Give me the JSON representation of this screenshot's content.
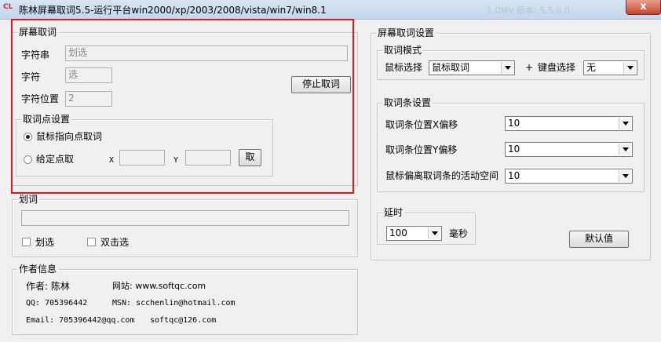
{
  "window": {
    "icon_text": "CL",
    "title": "陈林屏幕取词5.5-运行平台win2000/xp/2003/2008/vista/win7/win8.1",
    "ghost_text": "1.0MV   版本: 5.5.0.0",
    "close_glyph": "x"
  },
  "capture": {
    "legend": "屏幕取词",
    "string_label": "字符串",
    "string_value": "划选",
    "char_label": "字符",
    "char_value": "选",
    "pos_label": "字符位置",
    "pos_value": "2",
    "stop_button": "停止取词",
    "point_group": {
      "legend": "取词点设置",
      "option_mouse": "鼠标指向点取词",
      "option_fixed": "给定点取",
      "x_label": "X",
      "y_label": "Y",
      "x_value": "",
      "y_value": "",
      "take_button": "取"
    }
  },
  "select": {
    "legend": "划词",
    "text_value": "",
    "check_drag": "划选",
    "check_dblclick": "双击选"
  },
  "author": {
    "legend": "作者信息",
    "author_line": "作者: 陈林",
    "site_line": "网站: www.softqc.com",
    "qq_line": "QQ: 705396442",
    "msn_line": "MSN: scchenlin@hotmail.com",
    "email_line1": "Email: 705396442@qq.com",
    "email_line2": "softqc@126.com"
  },
  "settings": {
    "legend": "屏幕取词设置",
    "mode": {
      "legend": "取词模式",
      "mouse_label": "鼠标选择",
      "mouse_value": "鼠标取词",
      "plus": "+",
      "keyboard_label": "键盘选择",
      "keyboard_value": "无"
    },
    "bar": {
      "legend": "取词条设置",
      "x_offset_label": "取词条位置X偏移",
      "x_offset_value": "10",
      "y_offset_label": "取词条位置Y偏移",
      "y_offset_value": "10",
      "space_label": "鼠标偏离取词条的活动空间",
      "space_value": "10"
    },
    "delay": {
      "legend": "延时",
      "value": "100",
      "unit": "毫秒"
    },
    "default_button": "默认值"
  },
  "colors": {
    "highlight": "#e8151e",
    "window_bg": "#f0f0f0",
    "close_button": "#c8452f"
  }
}
